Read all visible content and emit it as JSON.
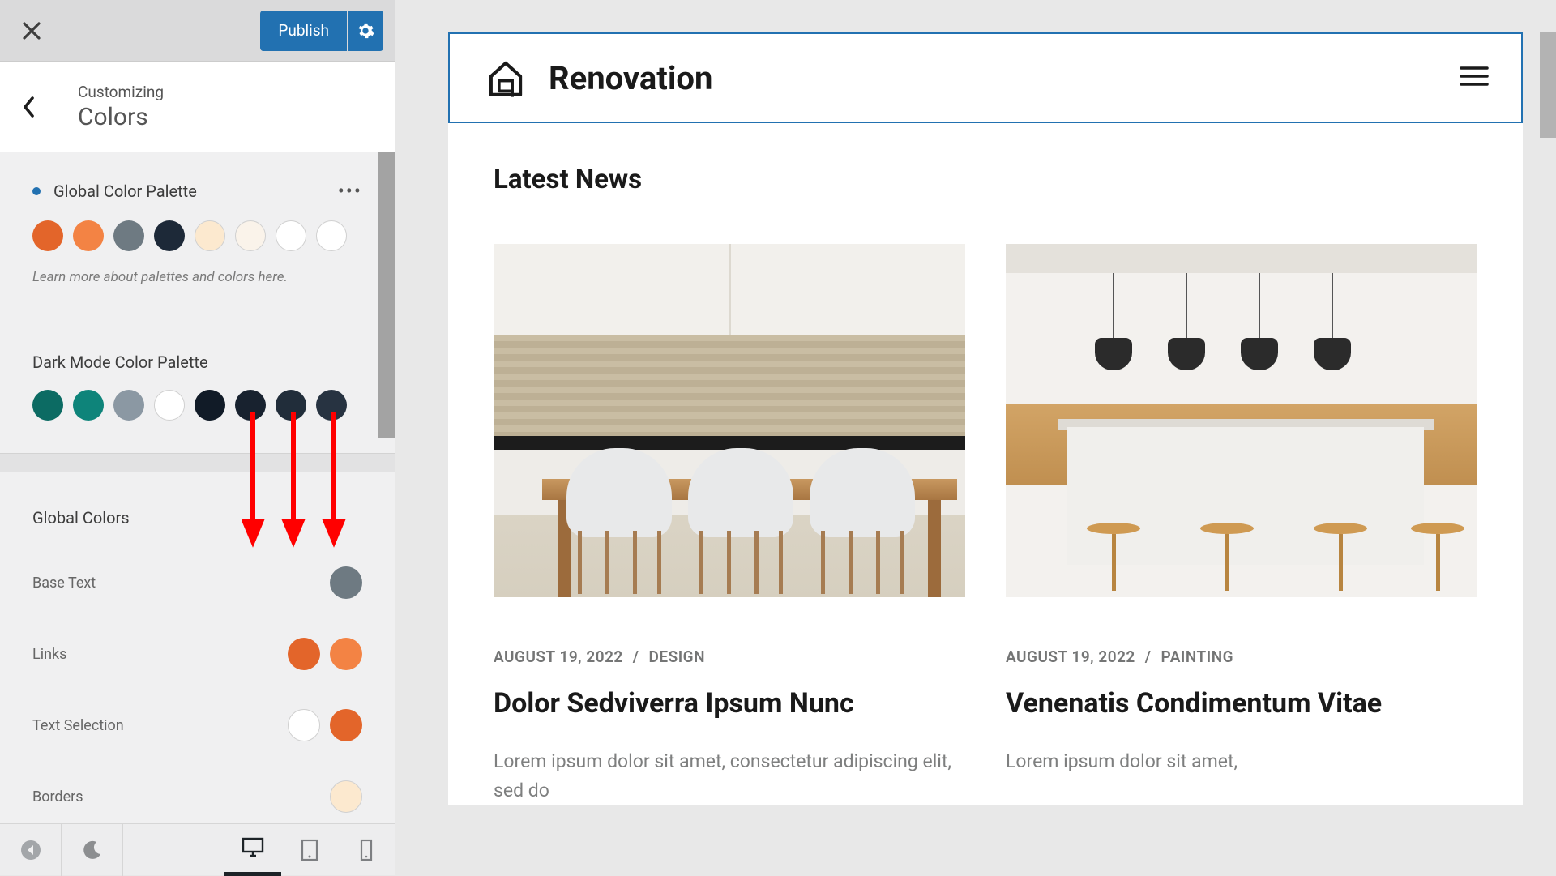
{
  "topbar": {
    "publish_label": "Publish"
  },
  "header": {
    "customizing": "Customizing",
    "title": "Colors"
  },
  "global_palette": {
    "title": "Global Color Palette",
    "hint": "Learn more about palettes and colors here.",
    "colors": [
      "#e3652a",
      "#f38344",
      "#6e7a82",
      "#1d2938",
      "#fce9cf",
      "#faf3ea",
      "#ffffff",
      "#ffffff"
    ]
  },
  "dark_palette": {
    "title": "Dark Mode Color Palette",
    "colors": [
      "#0c6b63",
      "#0e847a",
      "#8b98a3",
      "#ffffff",
      "#111b27",
      "#18222f",
      "#212d3a",
      "#273341"
    ]
  },
  "global_colors": {
    "title": "Global Colors",
    "rows": [
      {
        "label": "Base Text",
        "circles": [
          null,
          "#6e7a82"
        ]
      },
      {
        "label": "Links",
        "circles": [
          "#e3652a",
          "#f38344"
        ]
      },
      {
        "label": "Text Selection",
        "circles": [
          "#ffffff",
          "#e3652a"
        ]
      },
      {
        "label": "Borders",
        "circles": [
          null,
          "#fce9cf"
        ]
      }
    ]
  },
  "preview": {
    "site_name": "Renovation",
    "section_title": "Latest News",
    "posts": [
      {
        "date": "AUGUST 19, 2022",
        "category": "DESIGN",
        "title": "Dolor Sedviverra Ipsum Nunc",
        "excerpt": "Lorem ipsum dolor sit amet, consectetur adipiscing elit, sed do"
      },
      {
        "date": "AUGUST 19, 2022",
        "category": "PAINTING",
        "title": "Venenatis Condimentum Vitae",
        "excerpt": "Lorem ipsum dolor sit amet,"
      }
    ],
    "meta_sep": "/"
  }
}
